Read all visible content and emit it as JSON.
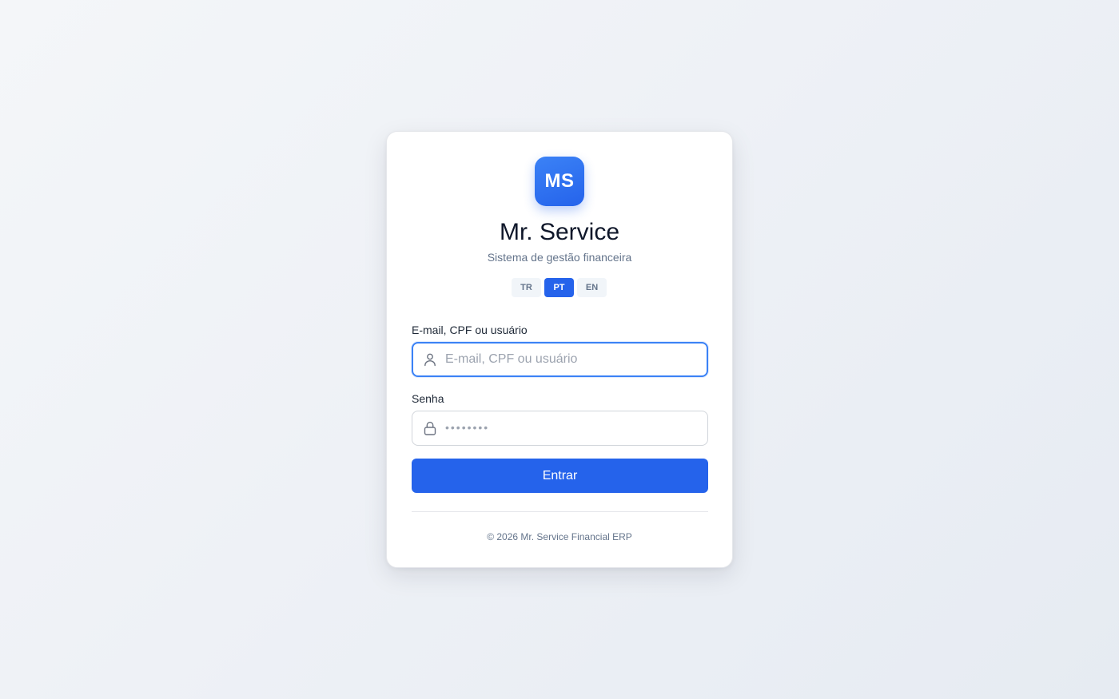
{
  "brand": {
    "logo_text": "MS",
    "title": "Mr. Service",
    "subtitle": "Sistema de gestão financeira",
    "accent_color": "#2563eb"
  },
  "languages": {
    "items": [
      {
        "code": "TR",
        "active": false
      },
      {
        "code": "PT",
        "active": true
      },
      {
        "code": "EN",
        "active": false
      }
    ]
  },
  "form": {
    "username": {
      "label": "E-mail, CPF ou usuário",
      "placeholder": "E-mail, CPF ou usuário",
      "value": "",
      "icon": "user-icon"
    },
    "password": {
      "label": "Senha",
      "placeholder": "••••••••",
      "value": "",
      "icon": "lock-icon"
    },
    "submit_label": "Entrar"
  },
  "footer": {
    "text": "© 2026 Mr. Service Financial ERP"
  }
}
